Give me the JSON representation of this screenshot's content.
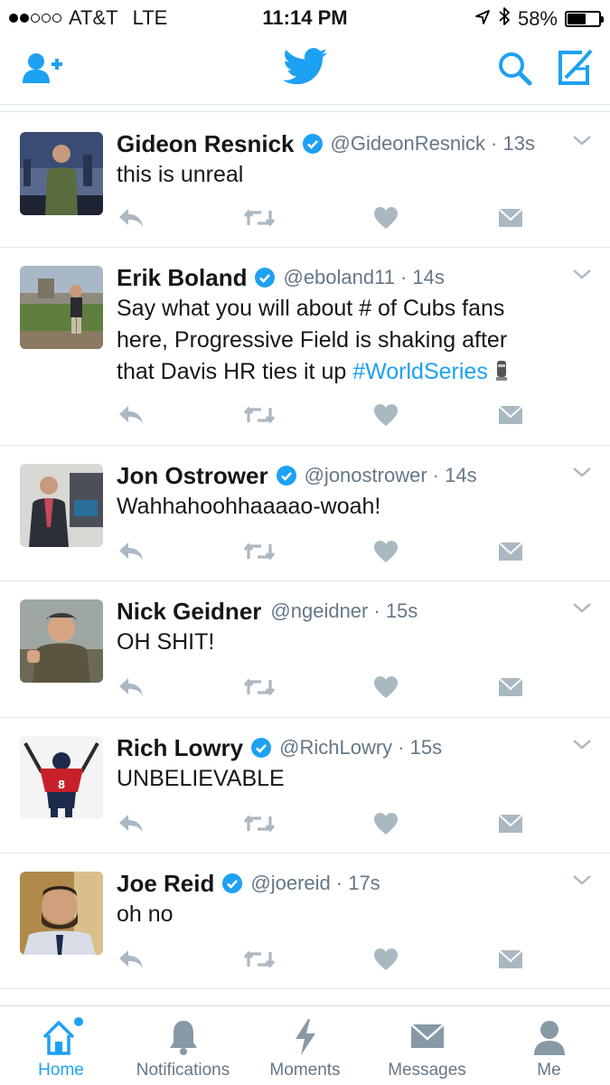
{
  "status_bar": {
    "carrier": "AT&T",
    "network": "LTE",
    "time": "11:14 PM",
    "battery": "58%",
    "battery_level": 0.58,
    "signal_bars": 2
  },
  "navbar": {
    "icons": [
      "add-user-icon",
      "twitter-bird-icon",
      "search-icon",
      "compose-icon"
    ]
  },
  "tweets": [
    {
      "name": "Gideon Resnick",
      "verified": true,
      "handle": "@GideonResnick",
      "time": "· 13s",
      "text": "this is unreal"
    },
    {
      "name": "Erik Boland",
      "verified": true,
      "handle": "@eboland11",
      "time": "· 14s",
      "text_lines": [
        "Say what you will about # of Cubs fans",
        "here, Progressive Field is shaking after",
        "that Davis HR ties it up"
      ],
      "hashtag": "#WorldSeries"
    },
    {
      "name": "Jon Ostrower",
      "verified": true,
      "handle": "@jonostrower",
      "time": "· 14s",
      "text": "Wahhahoohhaaaao-woah!"
    },
    {
      "name": "Nick Geidner",
      "verified": false,
      "handle": "@ngeidner",
      "time": "· 15s",
      "text": "OH SHIT!"
    },
    {
      "name": "Rich Lowry",
      "verified": true,
      "handle": "@RichLowry",
      "time": "· 15s",
      "text": "UNBELIEVABLE"
    },
    {
      "name": "Joe Reid",
      "verified": true,
      "handle": "@joereid",
      "time": "· 17s",
      "text": "oh no"
    }
  ],
  "tabbar": {
    "tabs": [
      {
        "label": "Home",
        "active": true
      },
      {
        "label": "Notifications",
        "active": false
      },
      {
        "label": "Moments",
        "active": false
      },
      {
        "label": "Messages",
        "active": false
      },
      {
        "label": "Me",
        "active": false
      }
    ]
  },
  "colors": {
    "accent": "#1da1f2",
    "icon_gray": "#aab8c2",
    "text_gray": "#657786"
  }
}
